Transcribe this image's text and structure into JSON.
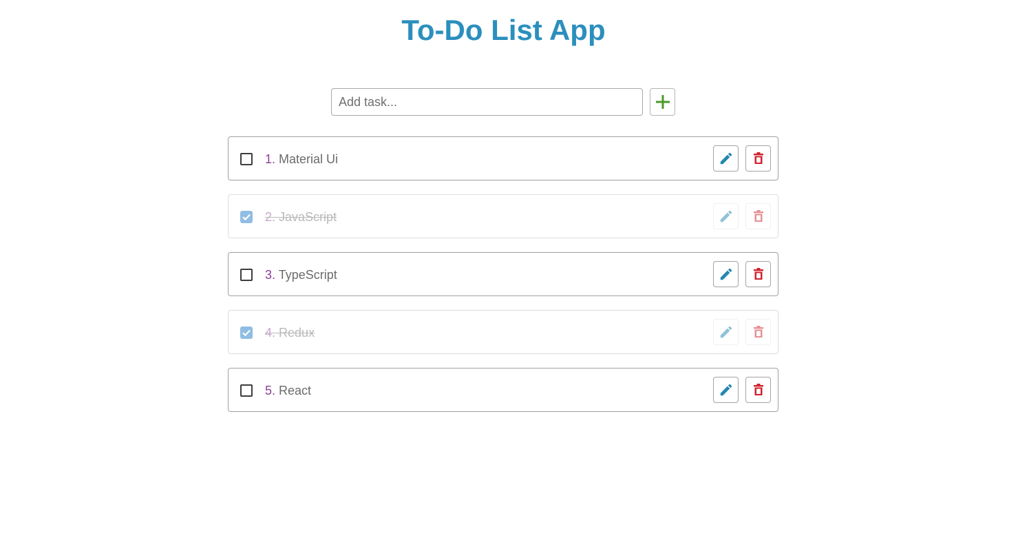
{
  "app": {
    "title": "To-Do List App",
    "title_color": "#2b8fbd"
  },
  "add_task": {
    "placeholder": "Add task...",
    "value": "",
    "add_icon": "plus-icon",
    "add_icon_color": "#4a9a2a"
  },
  "tasks": [
    {
      "number": "1.",
      "label": "Material Ui",
      "completed": false
    },
    {
      "number": "2.",
      "label": "JavaScript",
      "completed": true
    },
    {
      "number": "3.",
      "label": "TypeScript",
      "completed": false
    },
    {
      "number": "4.",
      "label": "Redux",
      "completed": true
    },
    {
      "number": "5.",
      "label": "React",
      "completed": false
    }
  ],
  "icons": {
    "edit": "pencil-icon",
    "delete": "trash-icon",
    "edit_color": "#2487b0",
    "delete_color": "#d0212d",
    "checkbox_checked_color": "#90bde3"
  }
}
